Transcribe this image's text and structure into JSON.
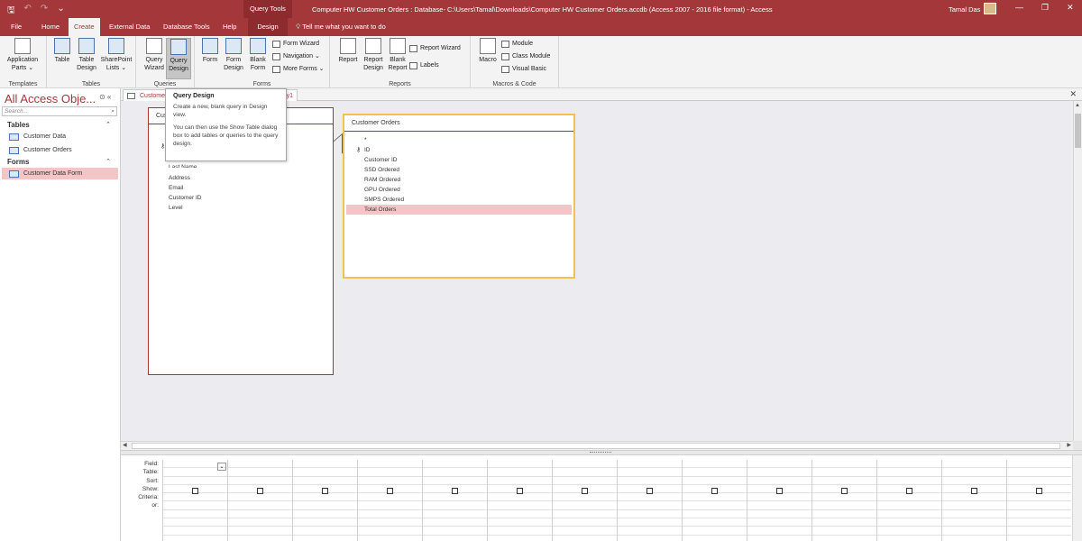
{
  "titlebar": {
    "qat": {
      "save_icon": "save-icon",
      "undo_icon": "undo-icon",
      "redo_icon": "redo-icon",
      "customize_icon": "chevron-down-icon"
    },
    "context_tools": "Query Tools",
    "document_title": "Computer HW Customer Orders : Database- C:\\Users\\Tamal\\Downloads\\Computer HW Customer Orders.accdb (Access 2007 - 2016 file format)  -  Access",
    "user": "Tamal Das",
    "minimize": "—",
    "restore": "❐",
    "close": "✕"
  },
  "tabs": [
    {
      "label": "File"
    },
    {
      "label": "Home"
    },
    {
      "label": "Create"
    },
    {
      "label": "External Data"
    },
    {
      "label": "Database Tools"
    },
    {
      "label": "Help"
    },
    {
      "label": "Design"
    }
  ],
  "tell_me": "Tell me what you want to do",
  "ribbon": {
    "templates": {
      "application_parts": [
        "Application",
        "Parts ⌄"
      ],
      "group": "Templates"
    },
    "tables": {
      "table": [
        "Table",
        ""
      ],
      "table_design": [
        "Table",
        "Design"
      ],
      "sharepoint_lists": [
        "SharePoint",
        "Lists ⌄"
      ],
      "group": "Tables"
    },
    "queries": {
      "query_wizard": [
        "Query",
        "Wizard"
      ],
      "query_design": [
        "Query",
        "Design"
      ],
      "group": "Queries"
    },
    "forms": {
      "form": [
        "Form",
        ""
      ],
      "form_design": [
        "Form",
        "Design"
      ],
      "blank_form": [
        "Blank",
        "Form"
      ],
      "form_wizard": "Form Wizard",
      "navigation": "Navigation ⌄",
      "more_forms": "More Forms ⌄",
      "group": "Forms"
    },
    "reports": {
      "report": [
        "Report",
        ""
      ],
      "report_design": [
        "Report",
        "Design"
      ],
      "blank_report": [
        "Blank",
        "Report"
      ],
      "report_wizard": "Report Wizard",
      "labels": "Labels",
      "group": "Reports"
    },
    "macros": {
      "macro": [
        "Macro",
        ""
      ],
      "module": "Module",
      "class_module": "Class Module",
      "visual_basic": "Visual Basic",
      "group": "Macros & Code"
    }
  },
  "nav": {
    "title": "All Access Obje...",
    "controls": "⊙ «",
    "search_placeholder": "Search...",
    "sections": [
      {
        "label": "Tables",
        "chev": "⌃",
        "items": [
          "Customer Data",
          "Customer Orders"
        ]
      },
      {
        "label": "Forms",
        "chev": "⌃",
        "items": [
          "Customer Data Form"
        ]
      }
    ]
  },
  "doc_tab": {
    "label": "Customer",
    "label_rest": "y1",
    "close": "✕"
  },
  "tooltip": {
    "title": "Query Design",
    "line1": "Create a new, blank query in Design view.",
    "line2": "You can then use the Show Table dialog box to add tables or queries to the query design."
  },
  "table1": {
    "title": "Cus",
    "key_icon": "key-icon",
    "fields": [
      "Last Name",
      "Address",
      "Email",
      "Customer ID",
      "Level"
    ]
  },
  "table2": {
    "title": "Customer Orders",
    "fields": [
      "*",
      "ID",
      "Customer ID",
      "SSD Ordered",
      "RAM Ordered",
      "GPU Ordered",
      "SMPS Ordered",
      "Total Orders"
    ],
    "selected_field": "Total Orders"
  },
  "qbe": {
    "row_labels": [
      "Field:",
      "Table:",
      "Sort:",
      "Show:",
      "Criteria:",
      "or:"
    ],
    "column_count": 14
  }
}
